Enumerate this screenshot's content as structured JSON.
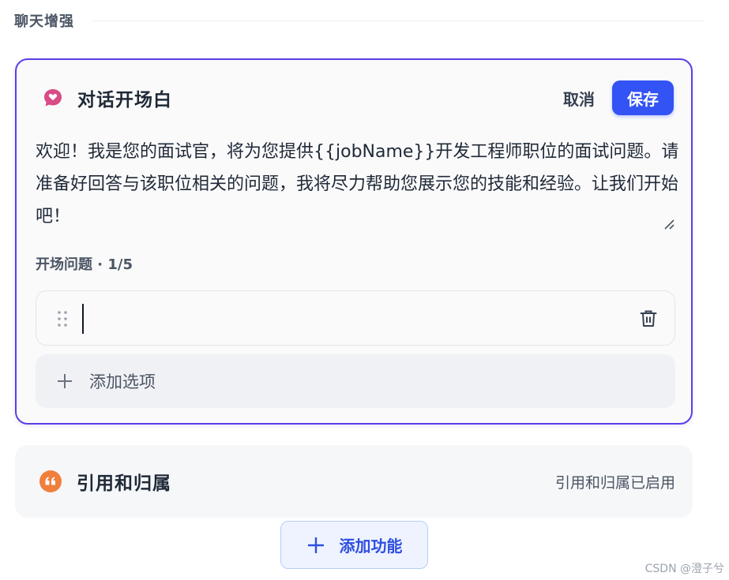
{
  "section": {
    "title": "聊天增强"
  },
  "opening": {
    "title": "对话开场白",
    "cancel_label": "取消",
    "save_label": "保存",
    "message": "欢迎！我是您的面试官，将为您提供{{jobName}}开发工程师职位的面试问题。请准备好回答与该职位相关的问题，我将尽力帮助您展示您的技能和经验。让我们开始吧！",
    "questions_label": "开场问题 · 1/5",
    "question_value": "",
    "add_option_label": "添加选项",
    "icon": "chat-heart-icon",
    "accent_color": "#5a3ee6",
    "save_color": "#3353f4"
  },
  "citation": {
    "title": "引用和归属",
    "status": "引用和归属已启用",
    "icon": "quote-icon",
    "icon_color": "#f07f3c"
  },
  "add_feature": {
    "label": "添加功能"
  },
  "watermark": "CSDN @澄子兮"
}
